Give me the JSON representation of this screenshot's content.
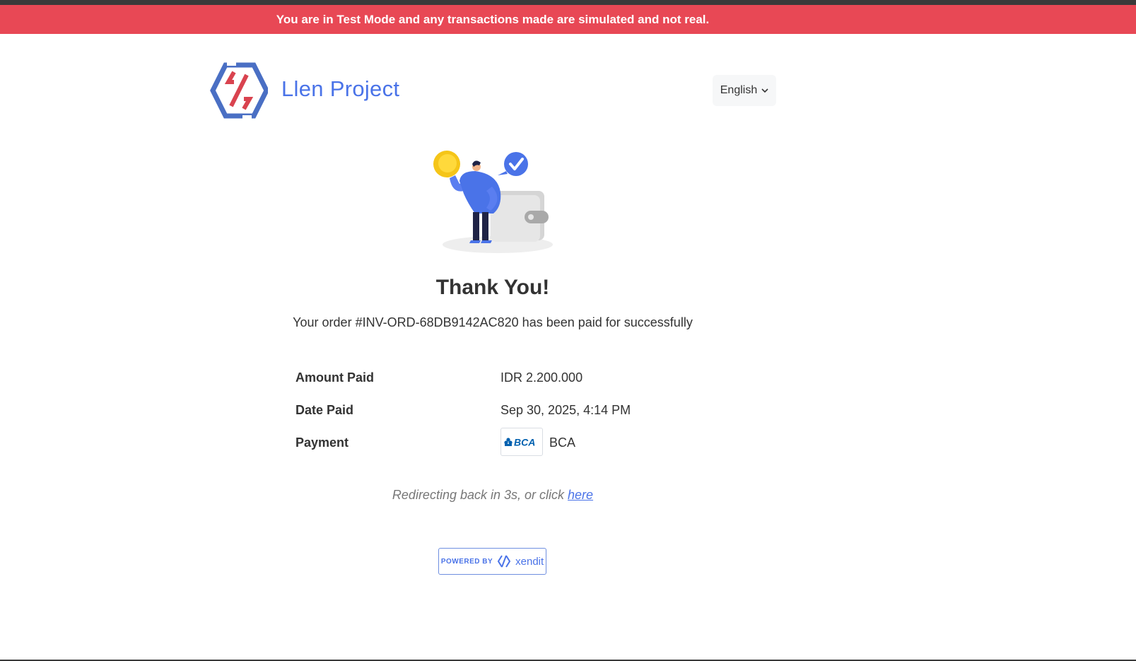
{
  "banner": {
    "text": "You are in Test Mode and any transactions made are simulated and not real.",
    "color": "#e84855"
  },
  "header": {
    "brand_name": "Llen Project",
    "language": "English",
    "brand_color": "#4a73e8"
  },
  "main": {
    "title": "Thank You!",
    "order_message": "Your order #INV-ORD-68DB9142AC820 has been paid for successfully",
    "details": [
      {
        "label": "Amount Paid",
        "value": "IDR 2.200.000"
      },
      {
        "label": "Date Paid",
        "value": "Sep 30, 2025, 4:14 PM"
      },
      {
        "label": "Payment",
        "value": "BCA",
        "icon": "bca-logo",
        "logo_text": "BCA"
      }
    ],
    "redirect_prefix": "Redirecting back in 3s, or click ",
    "redirect_link": "here"
  },
  "footer": {
    "powered_by": "POWERED BY",
    "provider": "xendit"
  },
  "icons": {
    "brand": "llen-project-logo-icon",
    "language_chevron": "chevron-down-icon",
    "illustration": "payment-success-illustration",
    "xendit": "xendit-logo-icon"
  }
}
